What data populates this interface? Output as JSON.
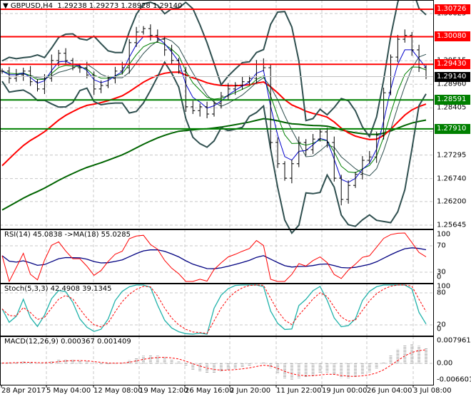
{
  "header": {
    "menu_icon": "triangle-down-icon",
    "symbol": "GBPUSD,H4",
    "open": "1.29238",
    "high": "1.29273",
    "low": "1.28928",
    "close": "1.29140"
  },
  "colors": {
    "resistance": "#ff0000",
    "support": "#008000",
    "current": "#000000",
    "bollinger": "#2f4f4f",
    "slow_ma": "#006400",
    "mid_ma": "#ff0000"
  },
  "price_axis": {
    "ticks": [
      "1.30625",
      "1.29515",
      "1.28960",
      "1.28405",
      "1.27850",
      "1.27295",
      "1.26740",
      "1.26200",
      "1.25645"
    ]
  },
  "levels": [
    {
      "label": "1.30726",
      "value": 1.30726,
      "kind": "resistance"
    },
    {
      "label": "1.30080",
      "value": 1.3008,
      "kind": "resistance"
    },
    {
      "label": "1.29430",
      "value": 1.2943,
      "kind": "resistance"
    },
    {
      "label": "1.28591",
      "value": 1.28591,
      "kind": "support"
    },
    {
      "label": "1.27910",
      "value": 1.2791,
      "kind": "support"
    }
  ],
  "current_price": {
    "label": "1.29140",
    "value": 1.2914
  },
  "time_axis": [
    "28 Apr 2017",
    "5 May 04:00",
    "12 May 08:00",
    "19 May 12:00",
    "26 May 16:00",
    "2 Jun 20:00",
    "11 Jun 22:00",
    "19 Jun 00:00",
    "26 Jun 04:00",
    "3 Jul 08:00"
  ],
  "rsi": {
    "title": "RSI(14) 45.0838  ->MA(18) 55.0285",
    "ticks": [
      "100",
      "70",
      "30",
      "0"
    ]
  },
  "stoch": {
    "title": "Stoch(5,3,3) 42.4908 39.1345",
    "ticks": [
      "100",
      "80",
      "20",
      "0"
    ]
  },
  "macd": {
    "title": "MACD(12,26,9) 0.000367 0.001409",
    "ticks": [
      "0.007961",
      "0.00",
      "-0.006601"
    ]
  },
  "chart_data": {
    "type": "line",
    "title": "GBPUSD,H4",
    "ylim": [
      1.25645,
      1.3085
    ],
    "grid": true,
    "close": [
      1.2927,
      1.291,
      1.2918,
      1.2927,
      1.2902,
      1.2885,
      1.291,
      1.2952,
      1.2969,
      1.2952,
      1.2935,
      1.2935,
      1.2918,
      1.2885,
      1.2893,
      1.291,
      1.2927,
      1.2935,
      1.2994,
      1.3019,
      1.3027,
      1.3011,
      1.3002,
      1.2977,
      1.2952,
      1.2927,
      1.2843,
      1.2834,
      1.2843,
      1.2826,
      1.2851,
      1.2868,
      1.2885,
      1.2893,
      1.2902,
      1.291,
      1.2943,
      1.2935,
      1.2759,
      1.2709,
      1.2675,
      1.2709,
      1.2759,
      1.2742,
      1.2767,
      1.2784,
      1.2759,
      1.2675,
      1.2625,
      1.2658,
      1.2684,
      1.2717,
      1.2725,
      1.2776,
      1.2876,
      1.296,
      1.3002,
      1.3011,
      1.2977,
      1.2935,
      1.2914
    ]
  }
}
